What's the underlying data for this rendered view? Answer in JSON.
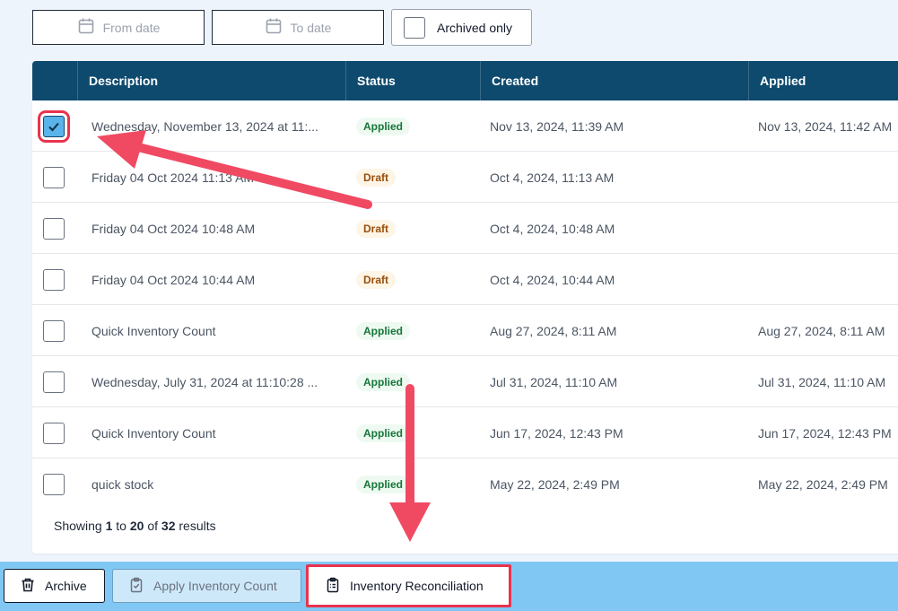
{
  "filters": {
    "from_date": "From date",
    "to_date": "To date",
    "archived_only": "Archived only"
  },
  "table": {
    "headers": [
      "Description",
      "Status",
      "Created",
      "Applied"
    ],
    "rows": [
      {
        "checked": true,
        "description": "Wednesday, November 13, 2024 at 11:...",
        "status": "Applied",
        "created": "Nov 13, 2024, 11:39 AM",
        "applied": "Nov 13, 2024, 11:42 AM"
      },
      {
        "checked": false,
        "description": "Friday 04 Oct 2024 11:13 AM",
        "status": "Draft",
        "created": "Oct 4, 2024, 11:13 AM",
        "applied": ""
      },
      {
        "checked": false,
        "description": "Friday 04 Oct 2024 10:48 AM",
        "status": "Draft",
        "created": "Oct 4, 2024, 10:48 AM",
        "applied": ""
      },
      {
        "checked": false,
        "description": "Friday 04 Oct 2024 10:44 AM",
        "status": "Draft",
        "created": "Oct 4, 2024, 10:44 AM",
        "applied": ""
      },
      {
        "checked": false,
        "description": "Quick Inventory Count",
        "status": "Applied",
        "created": "Aug 27, 2024, 8:11 AM",
        "applied": "Aug 27, 2024, 8:11 AM"
      },
      {
        "checked": false,
        "description": "Wednesday, July 31, 2024 at 11:10:28 ...",
        "status": "Applied",
        "created": "Jul 31, 2024, 11:10 AM",
        "applied": "Jul 31, 2024, 11:10 AM"
      },
      {
        "checked": false,
        "description": "Quick Inventory Count",
        "status": "Applied",
        "created": "Jun 17, 2024, 12:43 PM",
        "applied": "Jun 17, 2024, 12:43 PM"
      },
      {
        "checked": false,
        "description": "quick stock",
        "status": "Applied",
        "created": "May 22, 2024, 2:49 PM",
        "applied": "May 22, 2024, 2:49 PM"
      }
    ]
  },
  "pagination": {
    "showing": "Showing",
    "from": "1",
    "to_word": "to",
    "to": "20",
    "of_word": "of",
    "total": "32",
    "results": "results"
  },
  "actions": {
    "archive": "Archive",
    "apply": "Apply Inventory Count",
    "reconciliation": "Inventory Reconciliation"
  },
  "colors": {
    "header_bg": "#0e4a6e",
    "action_bar": "#81c7f4",
    "annotation": "#e9334e",
    "checkbox_checked": "#5ab3ea"
  },
  "icons": {
    "date": "calendar-icon",
    "archive": "trash-icon",
    "apply": "clipboard-check-icon",
    "reconciliation": "clipboard-list-icon",
    "check": "check-icon"
  }
}
